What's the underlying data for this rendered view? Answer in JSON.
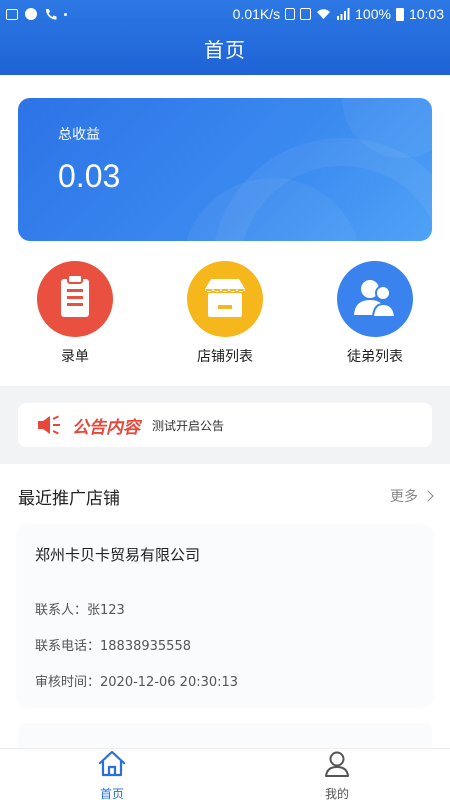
{
  "status_bar": {
    "speed": "0.01K/s",
    "battery": "100%",
    "time": "10:03"
  },
  "header": {
    "title": "首页"
  },
  "earnings": {
    "label": "总收益",
    "value": "0.03"
  },
  "quick_actions": [
    {
      "label": "录单",
      "icon": "clipboard-icon",
      "color": "#e9503f"
    },
    {
      "label": "店铺列表",
      "icon": "shop-icon",
      "color": "#f6b71c"
    },
    {
      "label": "徒弟列表",
      "icon": "users-icon",
      "color": "#3a83ee"
    }
  ],
  "notice": {
    "title": "公告内容",
    "text": "测试开启公告",
    "icon": "speaker-icon",
    "title_color": "#e8473a"
  },
  "recent": {
    "title": "最近推广店铺",
    "more": "更多",
    "shops": [
      {
        "name": "郑州卡贝卡贸易有限公司",
        "contact": "联系人：张123",
        "phone": "联系电话：18838935558",
        "review_time": "审核时间：2020-12-06 20:30:13"
      }
    ]
  },
  "tabbar": {
    "tabs": [
      {
        "label": "首页",
        "icon": "home-icon",
        "active": true
      },
      {
        "label": "我的",
        "icon": "user-icon",
        "active": false
      }
    ],
    "active_color": "#2a6fdc",
    "inactive_color": "#555555"
  }
}
